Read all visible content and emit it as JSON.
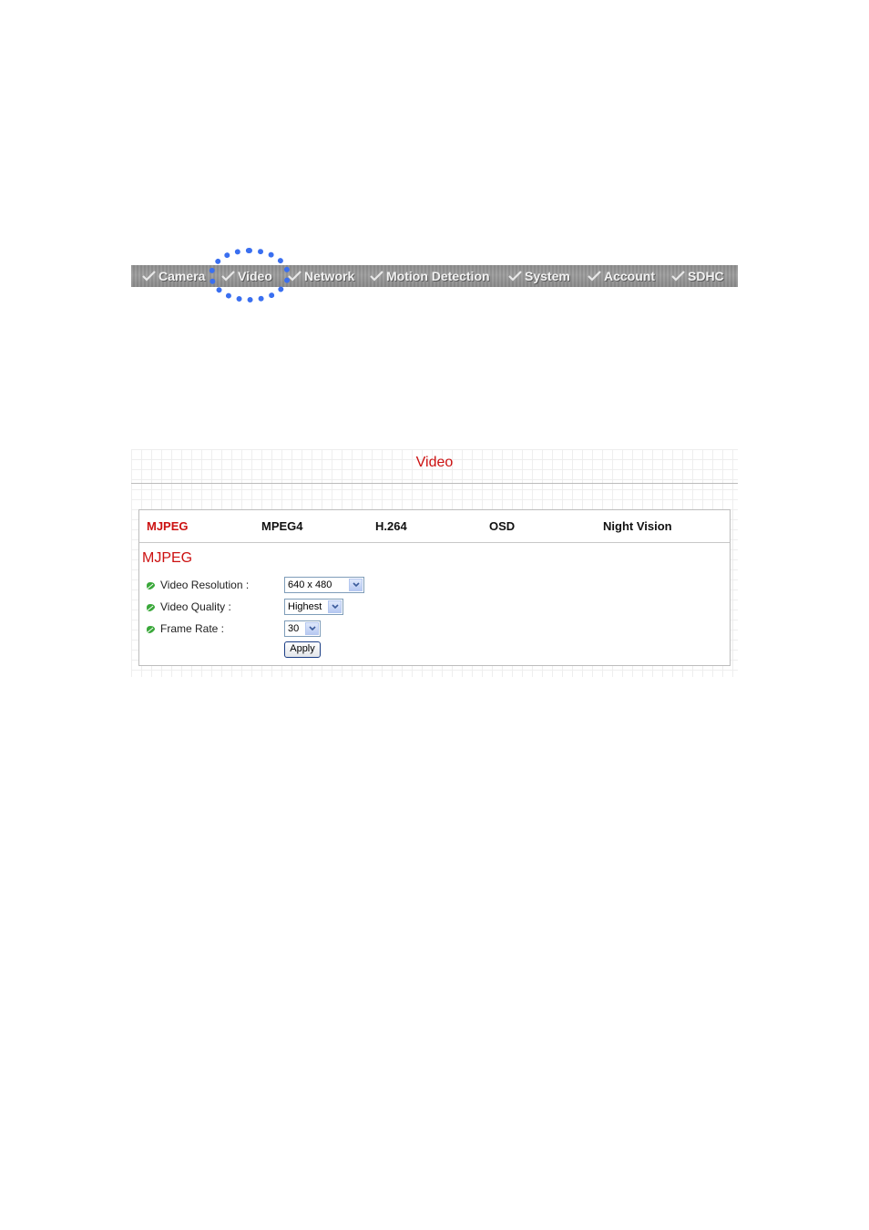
{
  "nav": {
    "items": [
      {
        "label": "Camera"
      },
      {
        "label": "Video"
      },
      {
        "label": "Network"
      },
      {
        "label": "Motion Detection"
      },
      {
        "label": "System"
      },
      {
        "label": "Account"
      },
      {
        "label": "SDHC"
      }
    ],
    "highlight_color": "#3a6ff0"
  },
  "panel": {
    "title": "Video",
    "tabs": [
      {
        "label": "MJPEG",
        "active": true
      },
      {
        "label": "MPEG4"
      },
      {
        "label": "H.264"
      },
      {
        "label": "OSD"
      },
      {
        "label": "Night Vision"
      }
    ],
    "section_title": "MJPEG",
    "fields": [
      {
        "label": "Video Resolution :",
        "value": "640 x 480"
      },
      {
        "label": "Video Quality :",
        "value": "Highest"
      },
      {
        "label": "Frame Rate :",
        "value": "30"
      }
    ],
    "apply_label": "Apply"
  },
  "colors": {
    "accent_red": "#cc1111",
    "nav_gray": "#9a9a9a",
    "leaf_green": "#3aa83a"
  },
  "icons": [
    "check-icon",
    "leaf-icon",
    "dropdown-arrow-icon"
  ]
}
